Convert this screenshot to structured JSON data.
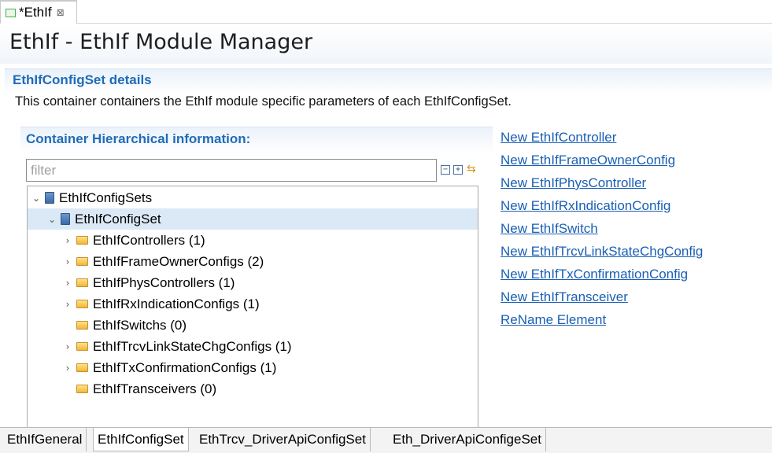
{
  "editor_tab": {
    "label": "*EthIf",
    "close_glyph": "⊠"
  },
  "header": {
    "title": "EthIf - EthIf Module Manager"
  },
  "section": {
    "title": "EthIfConfigSet details",
    "description": "This container containers the EthIf module specific parameters of each EthIfConfigSet."
  },
  "hierarchy": {
    "title": "Container Hierarchical information:",
    "filter_placeholder": "filter",
    "filter_value": "",
    "tools": {
      "collapse_glyph": "−",
      "expand_glyph": "+",
      "sync_glyph": "⇆"
    }
  },
  "tree": [
    {
      "label": "EthIfConfigSets",
      "twisty": "⌄",
      "icon": "config-icon"
    },
    {
      "label": "EthIfConfigSet",
      "twisty": "⌄",
      "icon": "config-icon",
      "selected": true
    },
    {
      "label": "EthIfControllers (1)",
      "twisty": "›",
      "icon": "folder-icon"
    },
    {
      "label": "EthIfFrameOwnerConfigs (2)",
      "twisty": "›",
      "icon": "folder-icon"
    },
    {
      "label": "EthIfPhysControllers (1)",
      "twisty": "›",
      "icon": "folder-icon"
    },
    {
      "label": "EthIfRxIndicationConfigs (1)",
      "twisty": "›",
      "icon": "folder-icon"
    },
    {
      "label": "EthIfSwitchs (0)",
      "twisty": "",
      "icon": "folder-icon"
    },
    {
      "label": "EthIfTrcvLinkStateChgConfigs (1)",
      "twisty": "›",
      "icon": "folder-icon"
    },
    {
      "label": "EthIfTxConfirmationConfigs (1)",
      "twisty": "›",
      "icon": "folder-icon"
    },
    {
      "label": "EthIfTransceivers (0)",
      "twisty": "",
      "icon": "folder-icon"
    }
  ],
  "actions": [
    "New EthIfController",
    "New EthIfFrameOwnerConfig",
    "New EthIfPhysController",
    "New EthIfRxIndicationConfig",
    "New EthIfSwitch",
    "New EthIfTrcvLinkStateChgConfig",
    "New EthIfTxConfirmationConfig",
    "New EthIfTransceiver",
    "ReName Element"
  ],
  "bottom_tabs": [
    {
      "label": "EthIfGeneral"
    },
    {
      "label": "EthIfConfigSet",
      "active": true
    },
    {
      "label": "EthTrcv_DriverApiConfigSet"
    },
    {
      "label": "Eth_DriverApiConfigeSet"
    }
  ],
  "colors": {
    "accent": "#1f6cb8",
    "link": "#1a5fb4",
    "selection": "#dbe9f7"
  }
}
